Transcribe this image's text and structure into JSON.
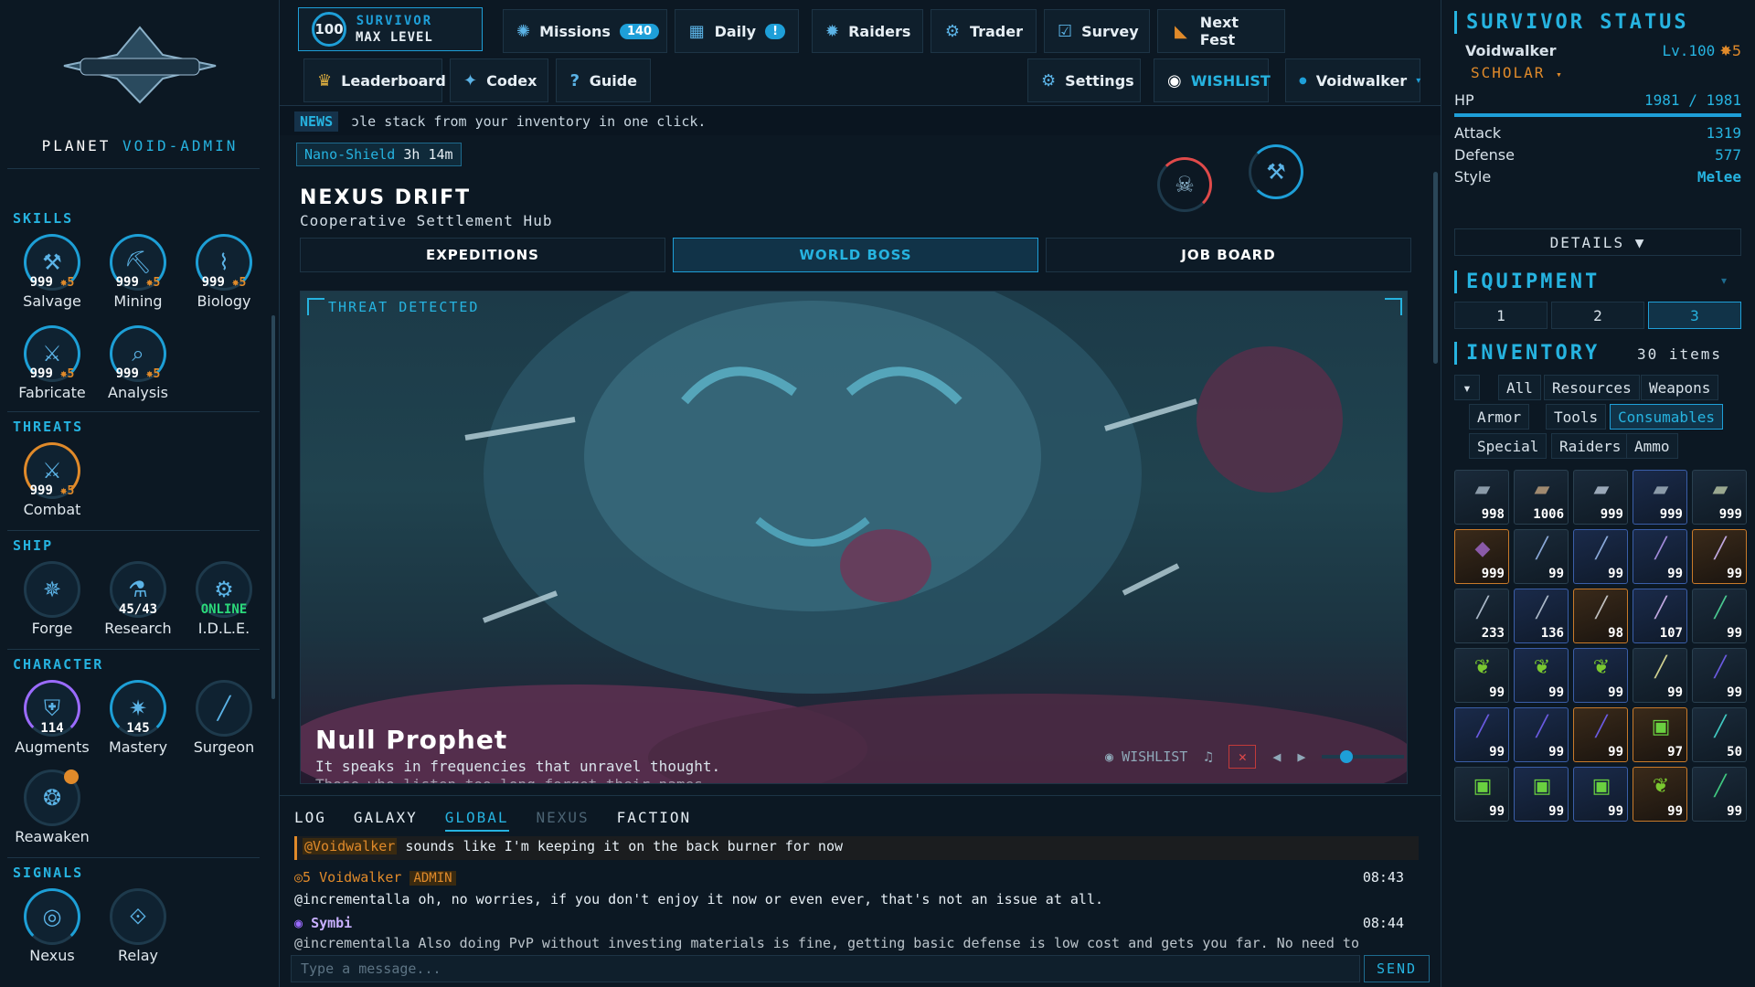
{
  "planet": {
    "label": "PLANET",
    "name": "VOID-ADMIN"
  },
  "skills": {
    "title": "SKILLS",
    "items": [
      {
        "name": "Salvage",
        "level": "999",
        "bonus": "5",
        "icon": "wrench-icon"
      },
      {
        "name": "Mining",
        "level": "999",
        "bonus": "5",
        "icon": "pickaxe-icon"
      },
      {
        "name": "Biology",
        "level": "999",
        "bonus": "5",
        "icon": "dna-icon"
      },
      {
        "name": "Fabricate",
        "level": "999",
        "bonus": "5",
        "icon": "anvil-icon"
      },
      {
        "name": "Analysis",
        "level": "999",
        "bonus": "5",
        "icon": "magnifier-icon"
      }
    ]
  },
  "threats": {
    "title": "THREATS",
    "items": [
      {
        "name": "Combat",
        "level": "999",
        "bonus": "5",
        "icon": "crossed-swords-icon"
      }
    ]
  },
  "ship": {
    "title": "SHIP",
    "items": [
      {
        "name": "Forge",
        "value": "",
        "icon": "forge-icon"
      },
      {
        "name": "Research",
        "value": "45/43",
        "icon": "flask-icon"
      },
      {
        "name": "I.D.L.E.",
        "value": "ONLINE",
        "icon": "robot-icon"
      }
    ]
  },
  "character": {
    "title": "CHARACTER",
    "items": [
      {
        "name": "Augments",
        "value": "114",
        "icon": "shield-icon"
      },
      {
        "name": "Mastery",
        "value": "145",
        "icon": "star-icon"
      },
      {
        "name": "Surgeon",
        "value": "",
        "icon": "scalpel-icon"
      },
      {
        "name": "Reawaken",
        "value": "",
        "icon": "reawaken-icon"
      }
    ]
  },
  "signals": {
    "title": "SIGNALS",
    "items": [
      {
        "name": "Nexus",
        "icon": "vortex-icon"
      },
      {
        "name": "Relay",
        "icon": "relay-icon"
      }
    ]
  },
  "topbar": {
    "survivor_level": "100",
    "survivor_label": "SURVIVOR",
    "survivor_sub": "MAX LEVEL",
    "missions": "Missions",
    "missions_count": "140",
    "daily": "Daily",
    "daily_badge": "!",
    "raiders": "Raiders",
    "trader": "Trader",
    "survey": "Survey",
    "nextfest": "Next Fest",
    "leaderboard": "Leaderboard",
    "codex": "Codex",
    "guide": "Guide",
    "settings": "Settings",
    "wishlist": "WISHLIST",
    "user": "Voidwalker"
  },
  "news": {
    "tag": "NEWS",
    "text": "ɔle stack from your inventory in one click."
  },
  "main": {
    "buff_name": "Nano-Shield",
    "buff_time": "3h 14m",
    "zone": "NEXUS DRIFT",
    "zone_sub": "Cooperative Settlement Hub",
    "tabs": [
      "EXPEDITIONS",
      "WORLD BOSS",
      "JOB BOARD"
    ],
    "active_tab": 1,
    "threat": "THREAT DETECTED",
    "boss_name": "Null Prophet",
    "boss_desc": "It speaks in frequencies that unravel thought.",
    "boss_desc2": "Those who listen too long forget their names.",
    "wishlist": "WISHLIST"
  },
  "chat": {
    "tabs": [
      "LOG",
      "GALAXY",
      "GLOBAL",
      "NEXUS",
      "FACTION"
    ],
    "active": 2,
    "quote_mention": "@Voidwalker",
    "quote_text": "sounds like I'm keeping it on the back burner for now",
    "m1_level": "5",
    "m1_user": "Voidwalker",
    "m1_badge": "ADMIN",
    "m1_time": "08:43",
    "m1_text": "@incrementalla oh, no worries, if you don't enjoy it now or even ever, that's not an issue at all.",
    "m2_user": "Symbi",
    "m2_time": "08:44",
    "m2_text": "@incrementalla Also doing PvP without investing materials is fine, getting basic defense is low cost and gets you far. No need to",
    "placeholder": "Type a message...",
    "send": "SEND"
  },
  "status": {
    "title": "SURVIVOR STATUS",
    "name": "Voidwalker",
    "level": "Lv.100",
    "bonus": "5",
    "class": "SCHOLAR",
    "hp_label": "HP",
    "hp": "1981 / 1981",
    "hp_fraction": 1.0,
    "attack_label": "Attack",
    "attack": "1319",
    "defense_label": "Defense",
    "defense": "577",
    "style_label": "Style",
    "style": "Melee",
    "details": "DETAILS ▼"
  },
  "equipment": {
    "title": "EQUIPMENT",
    "sets": [
      "1",
      "2",
      "3"
    ],
    "active": 2
  },
  "inventory": {
    "title": "INVENTORY",
    "count": "30 items",
    "filters": [
      "All",
      "Resources",
      "Weapons",
      "Armor",
      "Tools",
      "Consumables",
      "Special",
      "Raiders",
      "Ammo"
    ],
    "active_filter": "Consumables",
    "items": [
      {
        "q": "998",
        "t": "n",
        "g": "▰",
        "c": "#8a9aa8"
      },
      {
        "q": "1006",
        "t": "n",
        "g": "▰",
        "c": "#a08a70"
      },
      {
        "q": "999",
        "t": "n",
        "g": "▰",
        "c": "#9aa8b8"
      },
      {
        "q": "999",
        "t": "r",
        "g": "▰",
        "c": "#8a9aa8"
      },
      {
        "q": "999",
        "t": "n",
        "g": "▰",
        "c": "#9aa890"
      },
      {
        "q": "999",
        "t": "o",
        "g": "◆",
        "c": "#8a5aa8"
      },
      {
        "q": "99",
        "t": "n",
        "g": "╱",
        "c": "#8aa8d8"
      },
      {
        "q": "99",
        "t": "r",
        "g": "╱",
        "c": "#8aa8d8"
      },
      {
        "q": "99",
        "t": "r",
        "g": "╱",
        "c": "#a08ad8"
      },
      {
        "q": "99",
        "t": "o",
        "g": "╱",
        "c": "#c0a8e0"
      },
      {
        "q": "233",
        "t": "n",
        "g": "╱",
        "c": "#aab8c8"
      },
      {
        "q": "136",
        "t": "r",
        "g": "╱",
        "c": "#aab8c8"
      },
      {
        "q": "98",
        "t": "o",
        "g": "╱",
        "c": "#c0c0c0"
      },
      {
        "q": "107",
        "t": "r",
        "g": "╱",
        "c": "#c0a8e0"
      },
      {
        "q": "99",
        "t": "n",
        "g": "╱",
        "c": "#4ac890"
      },
      {
        "q": "99",
        "t": "n",
        "g": "❦",
        "c": "#7ac830"
      },
      {
        "q": "99",
        "t": "r",
        "g": "❦",
        "c": "#7ac830"
      },
      {
        "q": "99",
        "t": "r",
        "g": "❦",
        "c": "#7ac830"
      },
      {
        "q": "99",
        "t": "n",
        "g": "╱",
        "c": "#d0d090"
      },
      {
        "q": "99",
        "t": "n",
        "g": "╱",
        "c": "#6a5ae0"
      },
      {
        "q": "99",
        "t": "r",
        "g": "╱",
        "c": "#6a5ae0"
      },
      {
        "q": "99",
        "t": "r",
        "g": "╱",
        "c": "#6a5ae0"
      },
      {
        "q": "99",
        "t": "o",
        "g": "╱",
        "c": "#6a5ae0"
      },
      {
        "q": "97",
        "t": "o",
        "g": "▣",
        "c": "#6ad040"
      },
      {
        "q": "50",
        "t": "n",
        "g": "╱",
        "c": "#40c8c0"
      },
      {
        "q": "99",
        "t": "n",
        "g": "▣",
        "c": "#6ad040"
      },
      {
        "q": "99",
        "t": "r",
        "g": "▣",
        "c": "#6ad040"
      },
      {
        "q": "99",
        "t": "r",
        "g": "▣",
        "c": "#6ad040"
      },
      {
        "q": "99",
        "t": "o",
        "g": "❦",
        "c": "#7ac830"
      },
      {
        "q": "99",
        "t": "n",
        "g": "╱",
        "c": "#40c880"
      }
    ]
  }
}
